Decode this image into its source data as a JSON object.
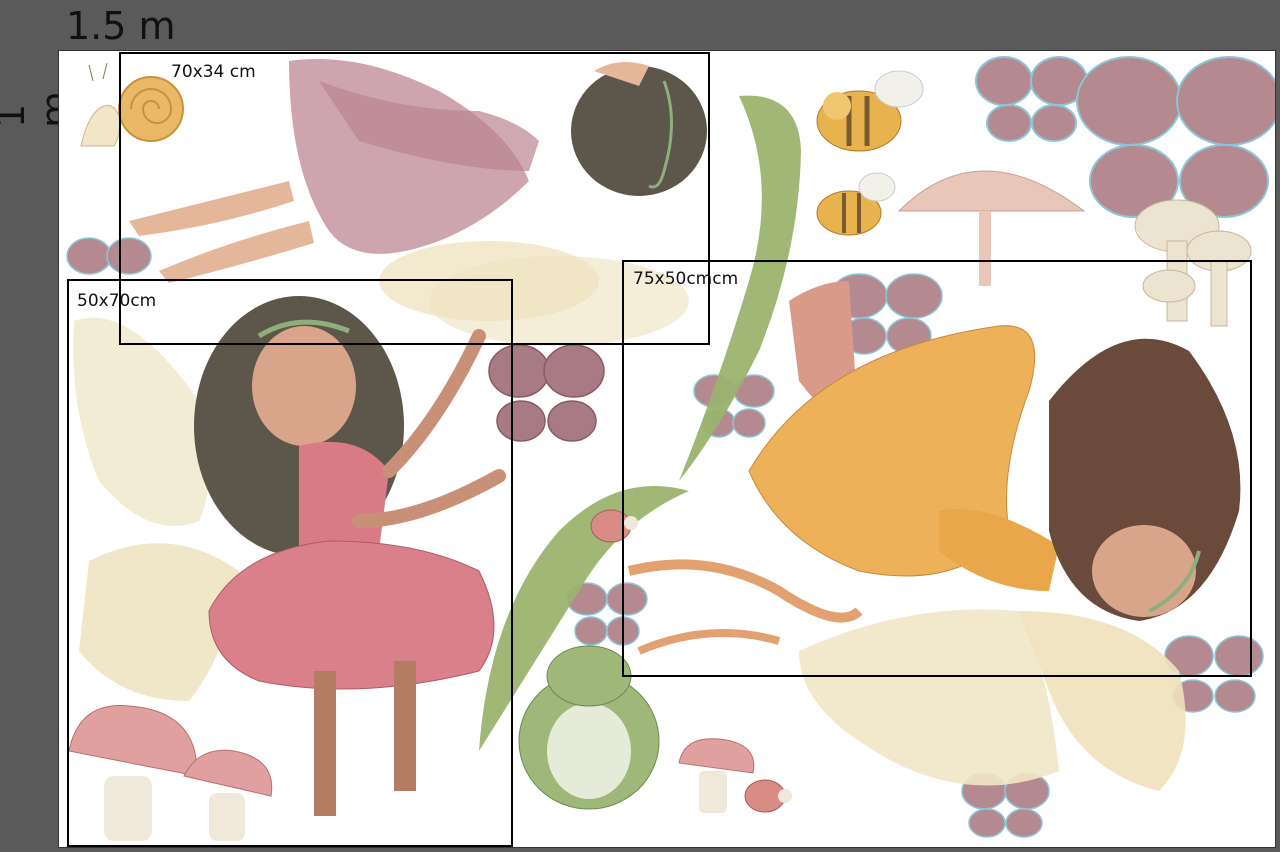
{
  "dimensions": {
    "width_label": "1.5 m",
    "height_label": "1 m"
  },
  "size_boxes": [
    {
      "id": "fairy-pink-lying",
      "label": "70x34 cm"
    },
    {
      "id": "fairy-rose-dancing",
      "label": "50x70cm"
    },
    {
      "id": "fairy-orange-floating",
      "label": "75x50cmcm"
    }
  ],
  "colors": {
    "background": "#5a5a5a",
    "sheet": "#ffffff",
    "box_border": "#000000"
  },
  "stickers": [
    "snail",
    "fairy-pink-lying",
    "bee",
    "bee",
    "butterfly",
    "butterfly",
    "mushroom-tan",
    "mushrooms-cream",
    "leaf-stem",
    "butterfly",
    "fairy-rose-dancing",
    "fairy-orange-floating",
    "ladybug",
    "frog",
    "mushrooms-pink",
    "ladybug",
    "mushroom-pink-small"
  ]
}
